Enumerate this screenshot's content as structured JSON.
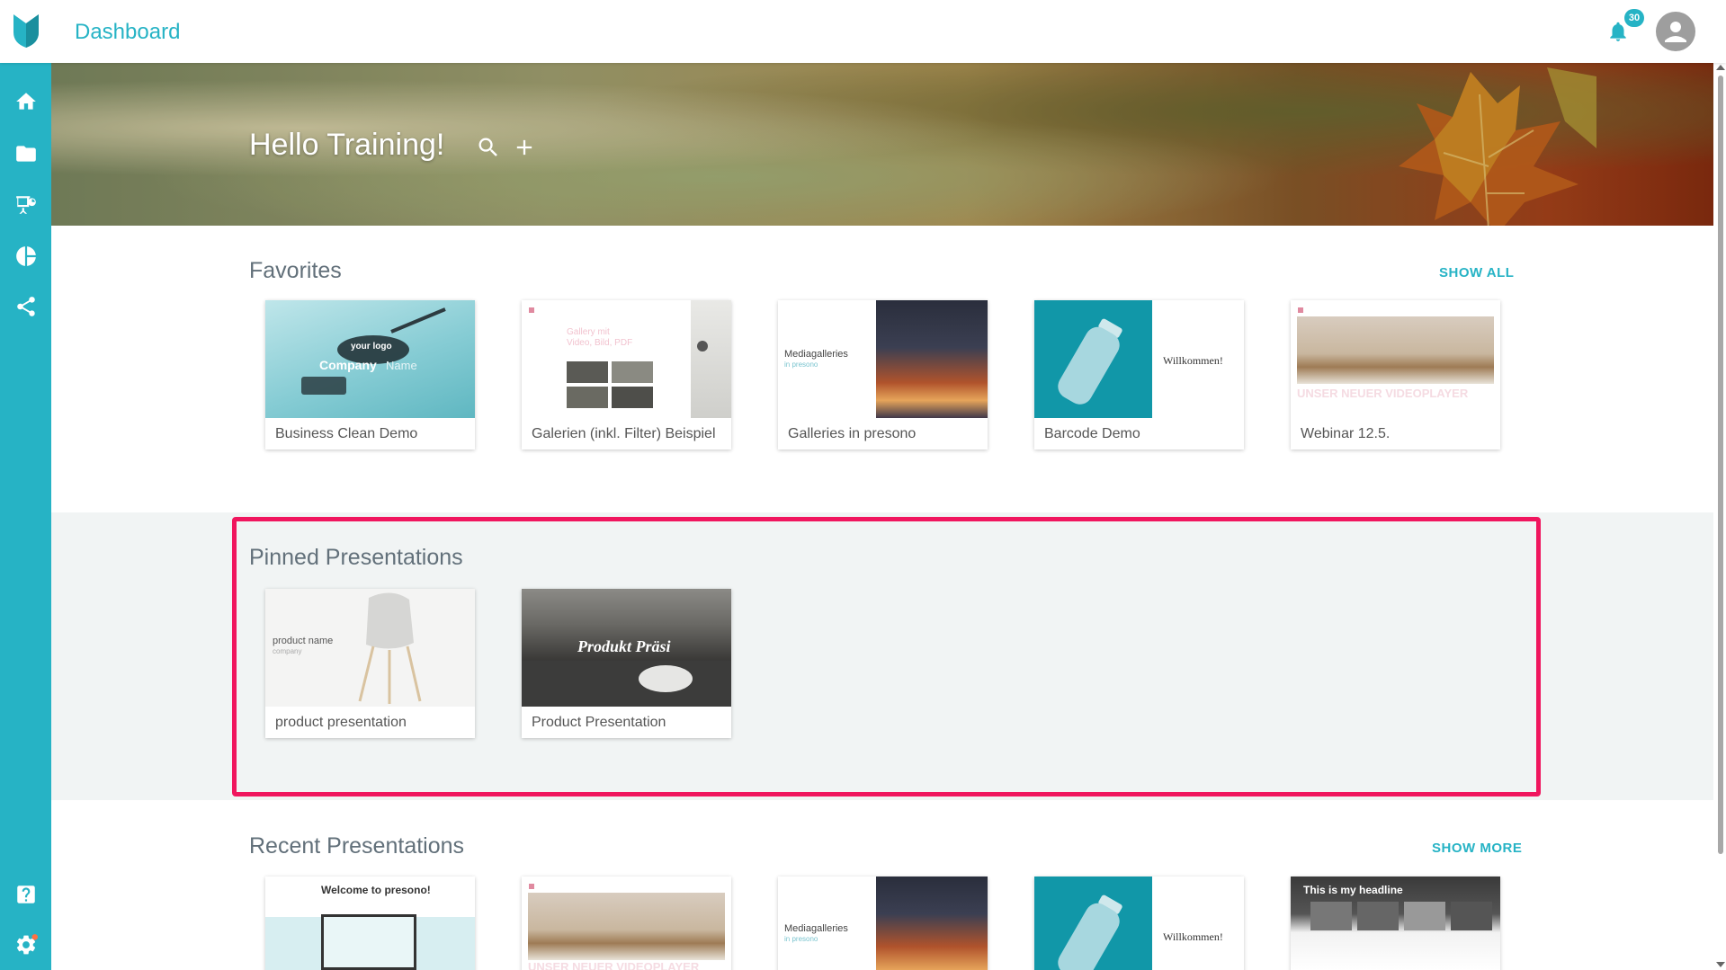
{
  "topbar": {
    "title": "Dashboard",
    "notification_count": "30"
  },
  "hero": {
    "greeting": "Hello Training!"
  },
  "sidebar": {
    "items": [
      {
        "icon": "home-icon"
      },
      {
        "icon": "folder-icon"
      },
      {
        "icon": "presentation-icon"
      },
      {
        "icon": "pie-chart-icon"
      },
      {
        "icon": "share-icon"
      },
      {
        "icon": "help-icon"
      },
      {
        "icon": "gear-icon"
      }
    ]
  },
  "favorites": {
    "title": "Favorites",
    "link": "SHOW ALL",
    "cards": [
      {
        "label": "Business Clean Demo",
        "thumb_text_1": "your logo",
        "thumb_text_2": "Company",
        "thumb_text_3": "Name"
      },
      {
        "label": "Galerien (inkl. Filter) Beispiel",
        "thumb_text_1": "Gallery mit",
        "thumb_text_2": "Video, Bild, PDF"
      },
      {
        "label": "Galleries in presono",
        "thumb_text_1": "Mediagalleries",
        "thumb_text_2": "in presono"
      },
      {
        "label": "Barcode Demo",
        "thumb_text_1": "Willkommen!"
      },
      {
        "label": "Webinar 12.5.",
        "thumb_text_1": "UNSER NEUER VIDEOPLAYER"
      }
    ]
  },
  "pinned": {
    "title": "Pinned Presentations",
    "cards": [
      {
        "label": "product presentation",
        "thumb_text_1": "product name",
        "thumb_text_2": "company"
      },
      {
        "label": "Product Presentation",
        "thumb_text_1": "Produkt Präsi"
      }
    ]
  },
  "recent": {
    "title": "Recent Presentations",
    "link": "SHOW MORE",
    "cards": [
      {
        "thumb_text_1": "Welcome to presono!"
      },
      {
        "thumb_text_1": "UNSER NEUER VIDEOPLAYER"
      },
      {
        "thumb_text_1": "Mediagalleries",
        "thumb_text_2": "in presono"
      },
      {
        "thumb_text_1": "Willkommen!"
      },
      {
        "thumb_text_1": "This is my headline"
      }
    ]
  },
  "colors": {
    "accent": "#26b3c5",
    "highlight": "#f0165e",
    "pinned_bg": "#f1f4f4"
  }
}
